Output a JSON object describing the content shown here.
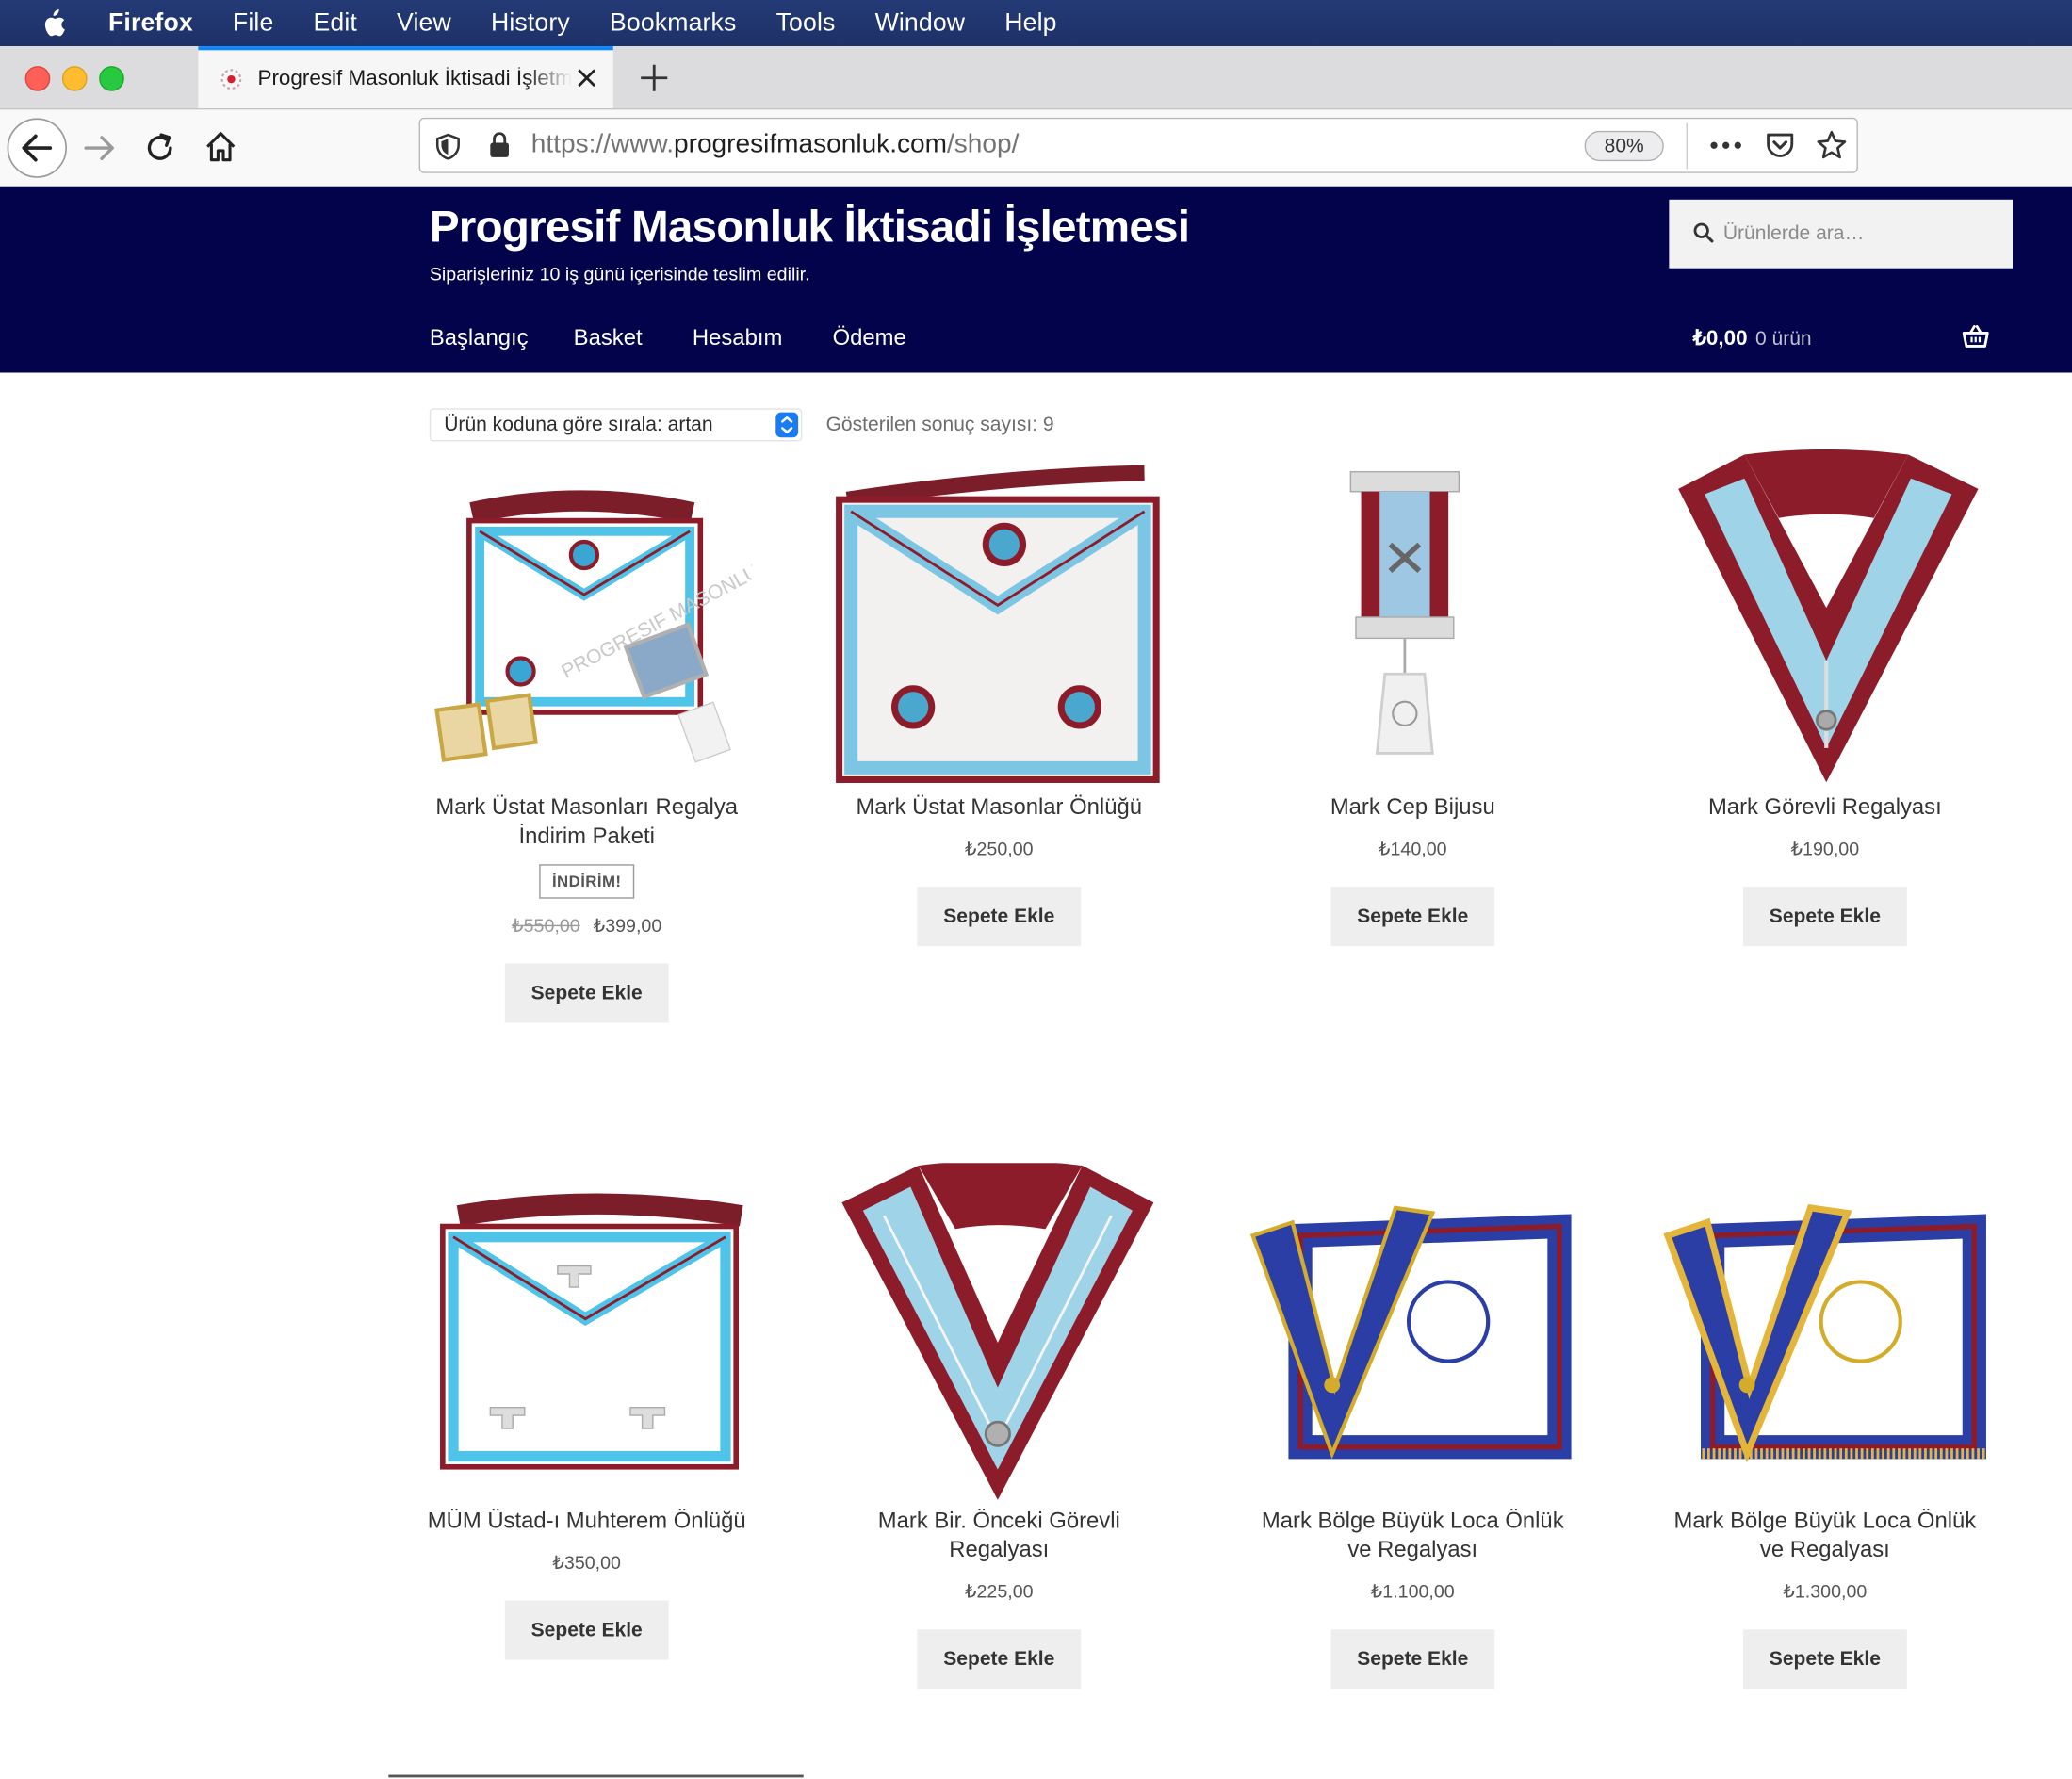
{
  "os_menubar": {
    "items": [
      "Firefox",
      "File",
      "Edit",
      "View",
      "History",
      "Bookmarks",
      "Tools",
      "Window",
      "Help"
    ]
  },
  "browser": {
    "tab_title": "Progresif Masonluk İktisadi İşletmesi",
    "url_scheme": "https://www.",
    "url_host": "progresifmasonluk.com",
    "url_path": "/shop/",
    "zoom": "80%",
    "accent_color": "#0a84ff"
  },
  "site": {
    "title": "Progresif Masonluk İktisadi İşletmesi",
    "tagline": "Siparişleriniz 10 iş günü içerisinde teslim edilir.",
    "search_placeholder": "Ürünlerde ara…",
    "header_color": "#02034a",
    "nav": [
      "Başlangıç",
      "Basket",
      "Hesabım",
      "Ödeme"
    ],
    "cart_amount": "₺0,00",
    "cart_count": "0 ürün"
  },
  "shop": {
    "sort_label": "Ürün koduna göre sırala: artan",
    "result_count": "Gösterilen sonuç sayısı: 9",
    "add_to_cart_label": "Sepete Ekle",
    "sale_badge": "İNDİRİM!",
    "products": [
      {
        "name": "Mark Üstat Masonları Regalya İndirim Paketi",
        "old_price": "₺550,00",
        "price": "₺399,00",
        "on_sale": true
      },
      {
        "name": "Mark Üstat Masonlar Önlüğü",
        "price": "₺250,00"
      },
      {
        "name": "Mark Cep Bijusu",
        "price": "₺140,00"
      },
      {
        "name": "Mark Görevli Regalyası",
        "price": "₺190,00"
      },
      {
        "name": "MÜM Üstad-ı Muhterem Önlüğü",
        "price": "₺350,00"
      },
      {
        "name": "Mark Bir. Önceki Görevli Regalyası",
        "price": "₺225,00"
      },
      {
        "name": "Mark Bölge Büyük Loca Önlük ve Regalyası",
        "price": "₺1.100,00"
      },
      {
        "name": "Mark Bölge Büyük Loca Önlük ve Regalyası",
        "price": "₺1.300,00"
      }
    ]
  }
}
